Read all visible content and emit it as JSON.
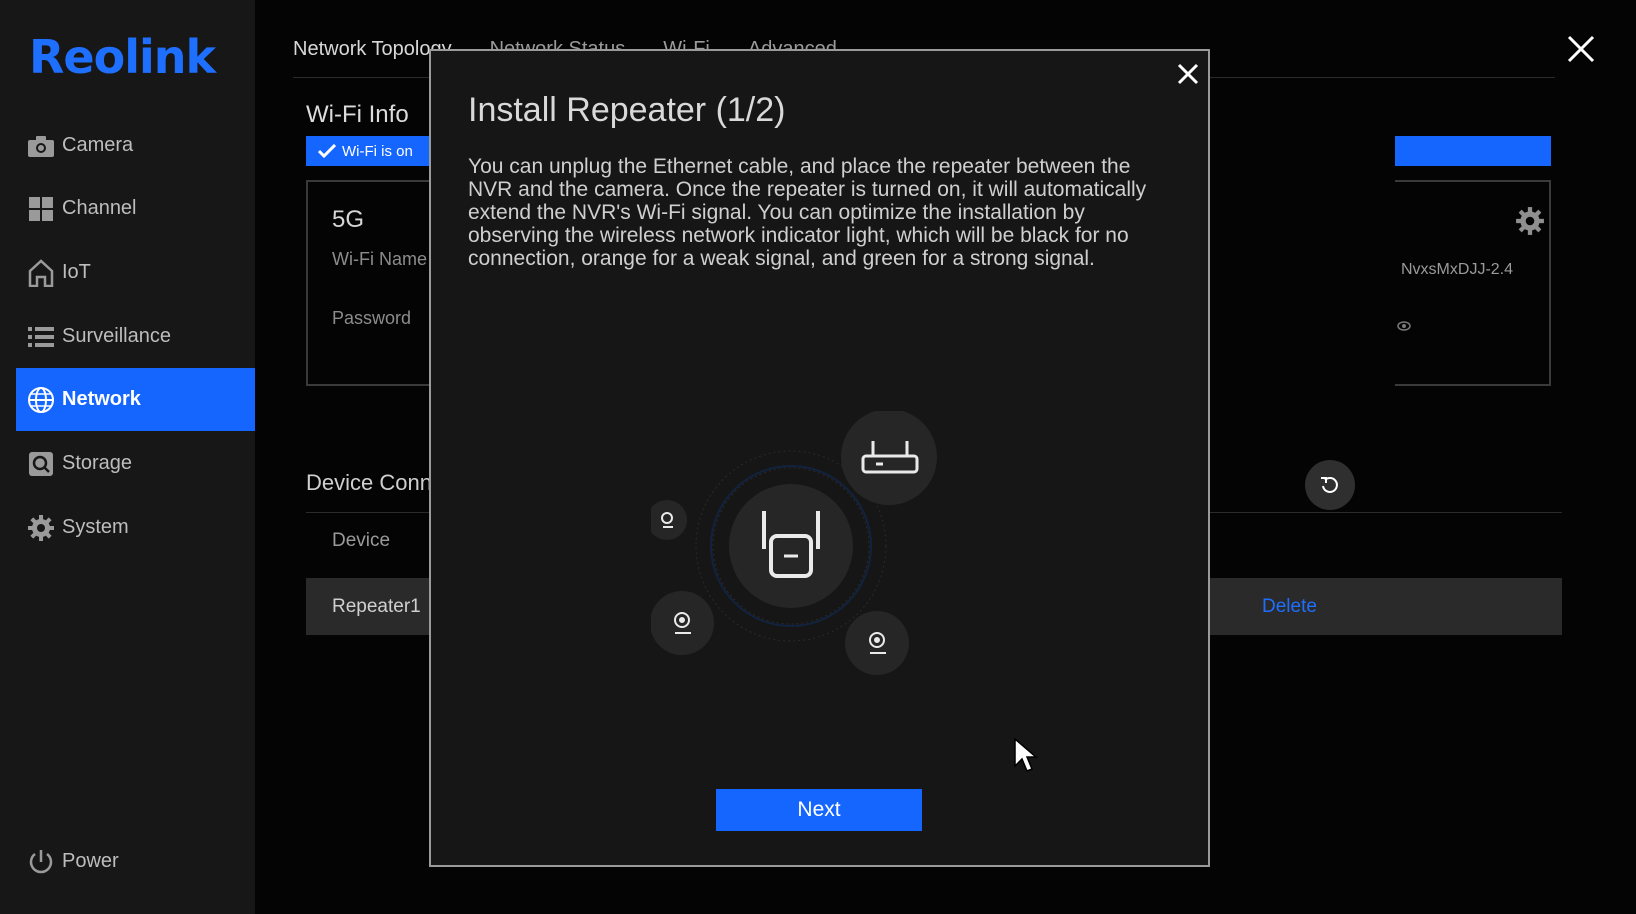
{
  "app": {
    "logo": "Reolink"
  },
  "sidebar": {
    "items": [
      {
        "label": "Camera",
        "icon": "camera-icon"
      },
      {
        "label": "Channel",
        "icon": "channel-grid-icon"
      },
      {
        "label": "IoT",
        "icon": "iot-home-icon"
      },
      {
        "label": "Surveillance",
        "icon": "list-icon"
      },
      {
        "label": "Network",
        "icon": "globe-icon",
        "active": true
      },
      {
        "label": "Storage",
        "icon": "storage-icon"
      },
      {
        "label": "System",
        "icon": "gear-icon"
      }
    ],
    "power_label": "Power"
  },
  "tabs": [
    "Network Topology",
    "Network Status",
    "Wi-Fi",
    "Advanced"
  ],
  "wifi": {
    "title": "Wi-Fi Info",
    "badge": "Wi-Fi is on",
    "band": "5G",
    "name_label": "Wi-Fi Name",
    "password_label": "Password",
    "ssid_24": "NvxsMxDJJ-2.4"
  },
  "devices": {
    "title": "Device Connection",
    "col_device": "Device",
    "row_name": "Repeater1",
    "delete_label": "Delete"
  },
  "modal": {
    "title": "Install Repeater (1/2)",
    "body": "You can unplug the Ethernet cable, and place the repeater between the NVR and the camera. Once the repeater is turned on, it will automatically extend the NVR's Wi-Fi signal. You can optimize the installation by observing the wireless network indicator light, which will be black for no connection, orange for a weak signal, and green for a strong signal.",
    "next_label": "Next"
  },
  "colors": {
    "accent": "#1565ff",
    "logo": "#1f6fff",
    "sidebar_bg": "#171717",
    "modal_bg": "#161616"
  }
}
